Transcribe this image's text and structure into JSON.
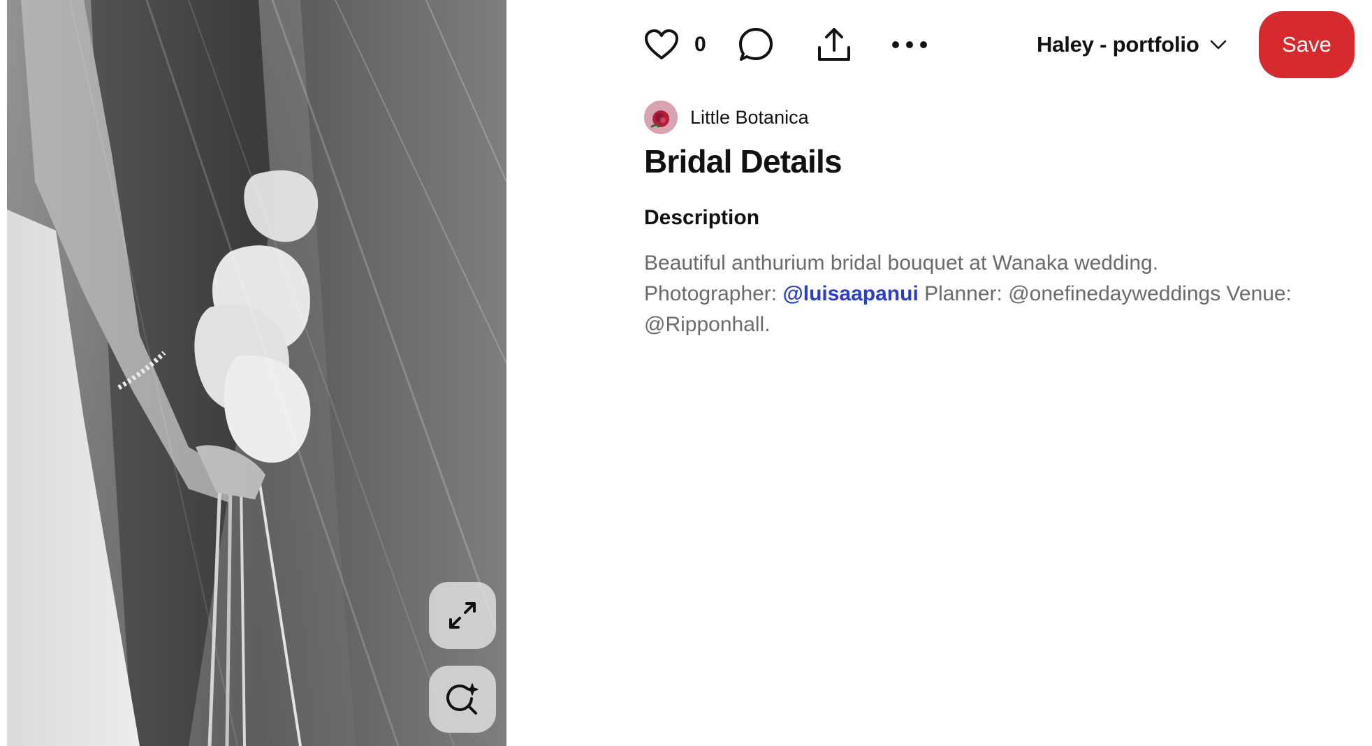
{
  "pin_image": {
    "expand_button_icon": "expand-arrows-icon",
    "visual_search_button_icon": "visual-search-lens-icon"
  },
  "toolbar": {
    "like_icon": "heart-icon",
    "like_count": "0",
    "comment_icon": "speech-bubble-icon",
    "share_icon": "share-upload-icon",
    "more_icon": "ellipsis-icon",
    "board_name": "Haley - portfolio",
    "board_chevron_icon": "chevron-down-icon",
    "save_label": "Save"
  },
  "creator": {
    "name": "Little Botanica",
    "avatar_icon": "rose-avatar"
  },
  "pin": {
    "title": "Bridal Details",
    "description_heading": "Description",
    "description_line1": "Beautiful anthurium bridal bouquet at Wanaka wedding.",
    "description_photographer_prefix": "Photographer: ",
    "description_photographer_mention": "@luisaapanui",
    "description_rest": " Planner: @onefinedayweddings Venue: @Ripponhall."
  },
  "colors": {
    "save_button": "#d72a2f",
    "mention_link": "#2b3fc4",
    "description_text": "#6a6a6a"
  }
}
